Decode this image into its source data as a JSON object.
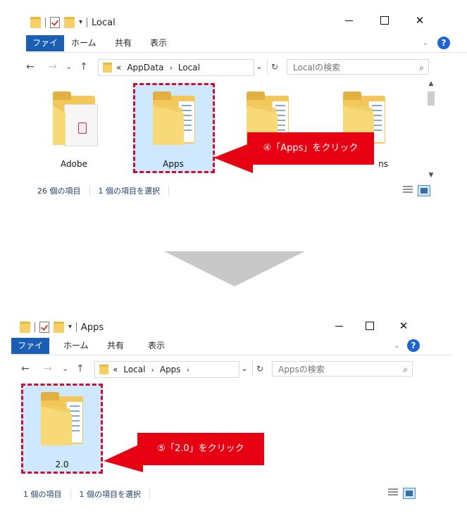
{
  "window1": {
    "title": "Local",
    "ribbon_tabs": [
      "ファイル",
      "ホーム",
      "共有",
      "表示"
    ],
    "path": [
      "AppData",
      "Local"
    ],
    "path_prefix": "«",
    "search_placeholder": "Localの検索",
    "folders": [
      {
        "label": "Adobe"
      },
      {
        "label": "Apps"
      },
      {
        "label": ""
      },
      {
        "label": "ns"
      }
    ],
    "status_count": "26 個の項目",
    "status_selected": "1 個の項目を選択",
    "callout": "④「Apps」をクリック"
  },
  "window2": {
    "title": "Apps",
    "ribbon_tabs": [
      "ファイル",
      "ホーム",
      "共有",
      "表示"
    ],
    "path": [
      "Local",
      "Apps"
    ],
    "path_prefix": "«",
    "search_placeholder": "Appsの検索",
    "folders": [
      {
        "label": "2.0"
      }
    ],
    "status_count": "1 個の項目",
    "status_selected": "1 個の項目を選択",
    "callout": "⑤「2.0」をクリック"
  },
  "icons": {
    "back": "←",
    "forward": "→",
    "recent": "⌄",
    "up": "↑",
    "refresh": "↻",
    "search": "⌕",
    "help": "?",
    "chevron": "⌄",
    "crumb_sep": "›",
    "addr_dropdown": "⌄"
  },
  "colors": {
    "accent": "#1a5fb4",
    "callout": "#e60012",
    "selection": "#cde8ff",
    "dash": "#c8102e"
  }
}
